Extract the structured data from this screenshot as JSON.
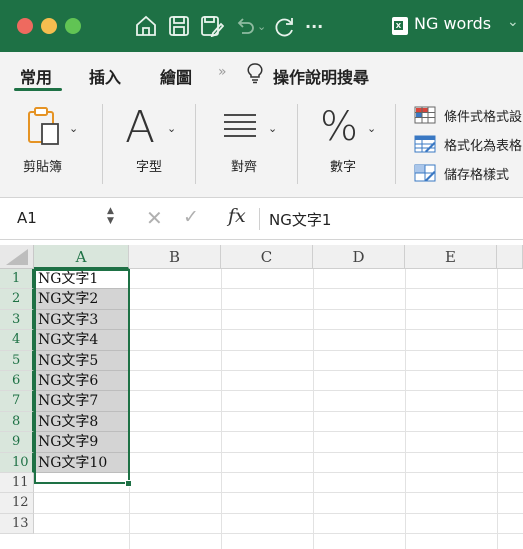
{
  "titlebar": {
    "document_title": "NG words",
    "title_chevron": "⌄",
    "icons": [
      "home-icon",
      "save-icon",
      "edit-save-icon",
      "undo-icon",
      "redo-icon",
      "more-icon",
      "excel-file-icon"
    ],
    "more_label": "···",
    "background": "#1e7145"
  },
  "tabs": {
    "items": [
      "常用",
      "插入",
      "繪圖"
    ],
    "active": "常用",
    "more": "»",
    "tell_me": "操作說明搜尋"
  },
  "ribbon": {
    "groups": [
      {
        "label": "剪貼簿",
        "icon": "clipboard-icon"
      },
      {
        "label": "字型",
        "glyph": "A"
      },
      {
        "label": "對齊",
        "icon": "align-icon"
      },
      {
        "label": "數字",
        "glyph": "%"
      }
    ],
    "styles": [
      "條件式格式設",
      "格式化為表格",
      "儲存格樣式"
    ]
  },
  "formula_bar": {
    "name_box": "A1",
    "fx": "fx",
    "content": "NG文字1"
  },
  "sheet": {
    "columns": [
      "A",
      "B",
      "C",
      "D",
      "E"
    ],
    "rows": [
      "1",
      "2",
      "3",
      "4",
      "5",
      "6",
      "7",
      "8",
      "9",
      "10",
      "11",
      "12",
      "13"
    ],
    "column_a": [
      "NG文字1",
      "NG文字2",
      "NG文字3",
      "NG文字4",
      "NG文字5",
      "NG文字6",
      "NG文字7",
      "NG文字8",
      "NG文字9",
      "NG文字10"
    ],
    "selected_range": "A1:A10",
    "accent": "#1e7145"
  }
}
